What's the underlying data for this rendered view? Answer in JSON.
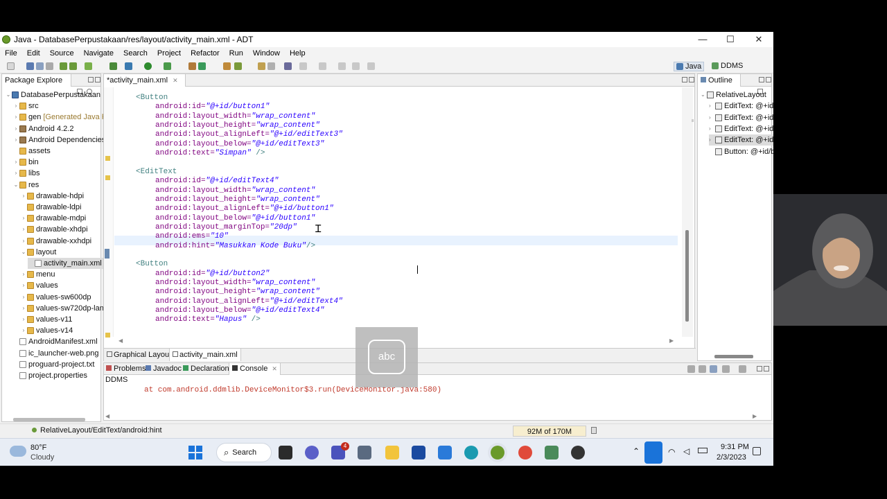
{
  "window": {
    "title": "Java - DatabasePerpustakaan/res/layout/activity_main.xml - ADT",
    "controls": {
      "minimize": "—",
      "maximize": "☐",
      "close": "✕"
    }
  },
  "menu": [
    "File",
    "Edit",
    "Source",
    "Navigate",
    "Search",
    "Project",
    "Refactor",
    "Run",
    "Window",
    "Help"
  ],
  "perspectives": {
    "java": "Java",
    "ddms": "DDMS"
  },
  "package_explorer": {
    "tab": "Package Explore",
    "items": [
      {
        "label": "DatabasePerpustakaan",
        "extra": ""
      },
      {
        "label": "src",
        "extra": ""
      },
      {
        "label": "gen",
        "extra": "[Generated Java Fil"
      },
      {
        "label": "Android 4.2.2",
        "extra": ""
      },
      {
        "label": "Android Dependencies",
        "extra": ""
      },
      {
        "label": "assets",
        "extra": ""
      },
      {
        "label": "bin",
        "extra": ""
      },
      {
        "label": "libs",
        "extra": ""
      },
      {
        "label": "res",
        "extra": ""
      },
      {
        "label": "drawable-hdpi",
        "extra": ""
      },
      {
        "label": "drawable-ldpi",
        "extra": ""
      },
      {
        "label": "drawable-mdpi",
        "extra": ""
      },
      {
        "label": "drawable-xhdpi",
        "extra": ""
      },
      {
        "label": "drawable-xxhdpi",
        "extra": ""
      },
      {
        "label": "layout",
        "extra": ""
      },
      {
        "label": "activity_main.xml",
        "extra": ""
      },
      {
        "label": "menu",
        "extra": ""
      },
      {
        "label": "values",
        "extra": ""
      },
      {
        "label": "values-sw600dp",
        "extra": ""
      },
      {
        "label": "values-sw720dp-lan",
        "extra": ""
      },
      {
        "label": "values-v11",
        "extra": ""
      },
      {
        "label": "values-v14",
        "extra": ""
      },
      {
        "label": "AndroidManifest.xml",
        "extra": ""
      },
      {
        "label": "ic_launcher-web.png",
        "extra": ""
      },
      {
        "label": "proguard-project.txt",
        "extra": ""
      },
      {
        "label": "project.properties",
        "extra": ""
      }
    ]
  },
  "editor": {
    "tab": "*activity_main.xml",
    "bottom_tabs": [
      "Graphical Layout",
      "activity_main.xml"
    ],
    "lines": [
      {
        "tag": "<Button",
        "attr": "",
        "val": "",
        "end": ""
      },
      {
        "tag": "",
        "attr": "android:id=",
        "val": "\"@+id/button1\"",
        "end": ""
      },
      {
        "tag": "",
        "attr": "android:layout_width=",
        "val": "\"wrap_content\"",
        "end": ""
      },
      {
        "tag": "",
        "attr": "android:layout_height=",
        "val": "\"wrap_content\"",
        "end": ""
      },
      {
        "tag": "",
        "attr": "android:layout_alignLeft=",
        "val": "\"@+id/editText3\"",
        "end": ""
      },
      {
        "tag": "",
        "attr": "android:layout_below=",
        "val": "\"@+id/editText3\"",
        "end": ""
      },
      {
        "tag": "",
        "attr": "android:text=",
        "val": "\"Simpan\"",
        "end": " />"
      },
      {
        "tag": "",
        "attr": "",
        "val": "",
        "end": ""
      },
      {
        "tag": "<EditText",
        "attr": "",
        "val": "",
        "end": ""
      },
      {
        "tag": "",
        "attr": "android:id=",
        "val": "\"@+id/editText4\"",
        "end": ""
      },
      {
        "tag": "",
        "attr": "android:layout_width=",
        "val": "\"wrap_content\"",
        "end": ""
      },
      {
        "tag": "",
        "attr": "android:layout_height=",
        "val": "\"wrap_content\"",
        "end": ""
      },
      {
        "tag": "",
        "attr": "android:layout_alignLeft=",
        "val": "\"@+id/button1\"",
        "end": ""
      },
      {
        "tag": "",
        "attr": "android:layout_below=",
        "val": "\"@+id/button1\"",
        "end": ""
      },
      {
        "tag": "",
        "attr": "android:layout_marginTop=",
        "val": "\"20dp\"",
        "end": ""
      },
      {
        "tag": "",
        "attr": "android:ems=",
        "val": "\"10\"",
        "end": ""
      },
      {
        "tag": "",
        "attr": "android:hint=",
        "val": "\"Masukkan Kode Buku\"",
        "end": "/>"
      },
      {
        "tag": "",
        "attr": "",
        "val": "",
        "end": ""
      },
      {
        "tag": "<Button",
        "attr": "",
        "val": "",
        "end": ""
      },
      {
        "tag": "",
        "attr": "android:id=",
        "val": "\"@+id/button2\"",
        "end": ""
      },
      {
        "tag": "",
        "attr": "android:layout_width=",
        "val": "\"wrap_content\"",
        "end": ""
      },
      {
        "tag": "",
        "attr": "android:layout_height=",
        "val": "\"wrap_content\"",
        "end": ""
      },
      {
        "tag": "",
        "attr": "android:layout_alignLeft=",
        "val": "\"@+id/editText4\"",
        "end": ""
      },
      {
        "tag": "",
        "attr": "android:layout_below=",
        "val": "\"@+id/editText4\"",
        "end": ""
      },
      {
        "tag": "",
        "attr": "android:text=",
        "val": "\"Hapus\"",
        "end": " />"
      }
    ]
  },
  "outline": {
    "tab": "Outline",
    "items": [
      "RelativeLayout",
      "EditText: @+id/",
      "EditText: @+id/",
      "EditText: @+id/",
      "EditText: @+id/",
      "Button: @+id/b"
    ]
  },
  "console": {
    "tabs": [
      "Problems",
      "Javadoc",
      "Declaration",
      "Console"
    ],
    "header": "DDMS",
    "line": "at com.android.ddmlib.DeviceMonitor$3.run(DeviceMonitor.java:580)"
  },
  "statusbar": {
    "path": "RelativeLayout/EditText/android:hint",
    "memory": "92M of 170M"
  },
  "ime_overlay": {
    "label": "abc"
  },
  "taskbar": {
    "weather_temp": "80°F",
    "weather_desc": "Cloudy",
    "search_label": "Search",
    "teams_badge": "4",
    "time": "9:31 PM",
    "date": "2/3/2023"
  },
  "colors": {
    "tag": "#3f7f7f",
    "attribute": "#7f007f",
    "value": "#2a00ff",
    "console_error": "#c0392b",
    "current_line": "#e8f2fe"
  }
}
